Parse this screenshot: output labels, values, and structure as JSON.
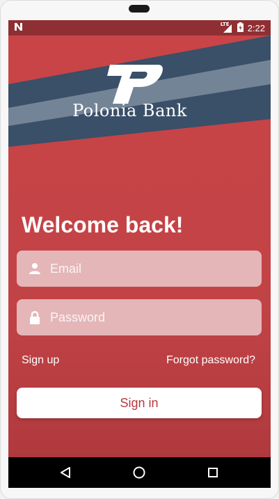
{
  "status_bar": {
    "time": "2:22",
    "network_label": "LTE",
    "icons": [
      "n-notification-icon",
      "signal-icon",
      "battery-icon"
    ]
  },
  "brand": {
    "name": "Polonia Bank",
    "logo_letter": "P",
    "colors": {
      "red": "#c94447",
      "navy": "#3a4f68",
      "stripe": "#748497"
    }
  },
  "login": {
    "heading": "Welcome back!",
    "email": {
      "placeholder": "Email",
      "value": "",
      "icon": "person-icon"
    },
    "password": {
      "placeholder": "Password",
      "value": "",
      "icon": "lock-icon"
    },
    "sign_up_label": "Sign up",
    "forgot_label": "Forgot password?",
    "sign_in_label": "Sign in"
  },
  "nav_bar": {
    "icons": [
      "back-icon",
      "home-icon",
      "recents-icon"
    ]
  }
}
